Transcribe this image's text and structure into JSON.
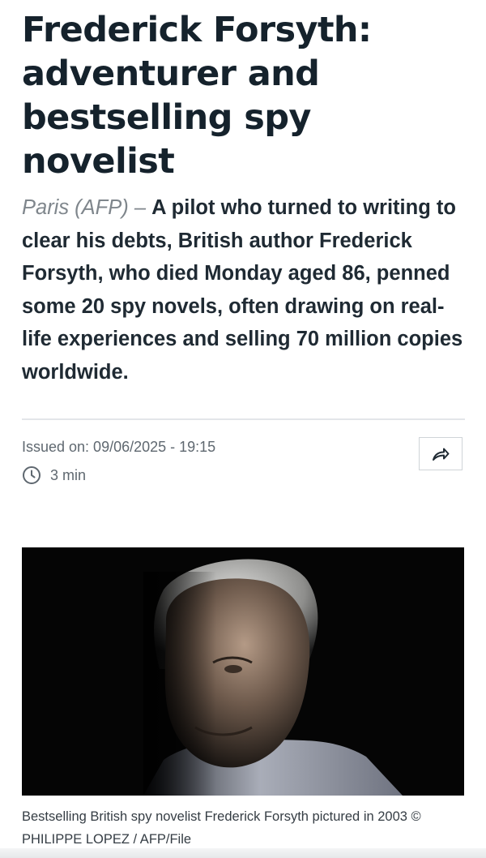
{
  "article": {
    "headline": "Frederick Forsyth: adventurer and bestselling spy novelist",
    "dateline": "Paris (AFP)",
    "dateline_sep": " – ",
    "lead": "A pilot who turned to writing to clear his debts, British author Frederick Forsyth, who died Monday aged 86, penned some 20 spy novels, often drawing on real-life experiences and selling 70 million copies worldwide.",
    "issued": "Issued on: 09/06/2025 - 19:15",
    "read_time": "3 min",
    "caption": "Bestselling British spy novelist Frederick Forsyth pictured in 2003 © PHILIPPE LOPEZ / AFP/File"
  },
  "icons": {
    "share": "share-arrow-icon",
    "clock": "clock-icon"
  },
  "colors": {
    "headline": "#15222c",
    "text": "#1f2a33",
    "muted": "#7f868c",
    "photo_background": "#050505"
  }
}
